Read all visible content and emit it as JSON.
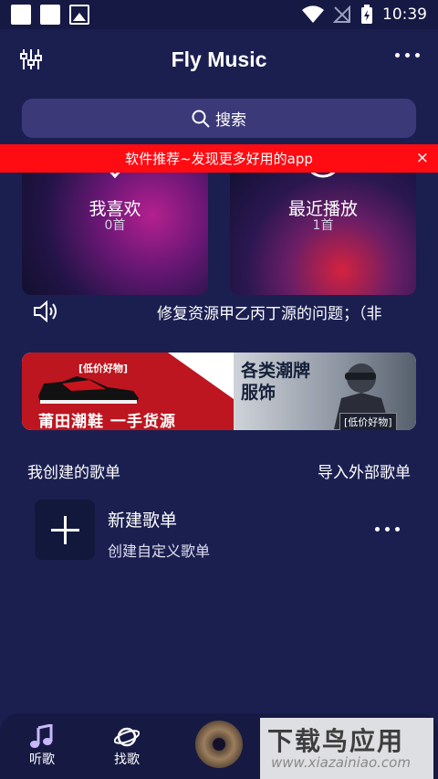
{
  "status_bar": {
    "time": "10:39",
    "icons_left": [
      "notification-square-icon",
      "notification-square-icon",
      "image-notification-icon"
    ],
    "icons_right": [
      "wifi-icon",
      "no-signal-icon",
      "battery-charging-icon"
    ]
  },
  "header": {
    "title": "Fly Music",
    "left_icon": "equalizer-icon",
    "right_icon": "more-dots-icon"
  },
  "search": {
    "label": "搜索",
    "icon": "search-icon"
  },
  "promo_banner": {
    "text": "软件推荐~发现更多好用的app",
    "close": "×",
    "color": "#ff0b12"
  },
  "cards": [
    {
      "title": "我喜欢",
      "count": "0首",
      "icon": "heart-icon"
    },
    {
      "title": "最近播放",
      "count": "1首",
      "icon": "play-icon"
    }
  ],
  "notice": {
    "icon": "speaker-icon",
    "text": "修复资源甲乙丙丁源的问题；（非"
  },
  "ad": {
    "tag_left": "[低价好物]",
    "main_left": "莆田潮鞋  一手货源",
    "main_right_line1": "各类潮牌",
    "main_right_line2": "服饰",
    "tag_right": "[低价好物]"
  },
  "playlists_section": {
    "title": "我创建的歌单",
    "import_label": "导入外部歌单"
  },
  "new_playlist": {
    "icon": "plus-icon",
    "title": "新建歌单",
    "subtitle": "创建自定义歌单",
    "more_icon": "more-dots-icon"
  },
  "tabbar": {
    "tabs": [
      {
        "label": "听歌",
        "icon": "music-note-icon"
      },
      {
        "label": "找歌",
        "icon": "planet-icon"
      }
    ],
    "center": "now-playing-disc"
  },
  "watermark": {
    "big": "下载鸟应用",
    "small": "www.xiazainiao.com"
  },
  "colors": {
    "background": "#1b1f50",
    "search_bg": "#3c3979",
    "tab_active": "#ffffff"
  }
}
